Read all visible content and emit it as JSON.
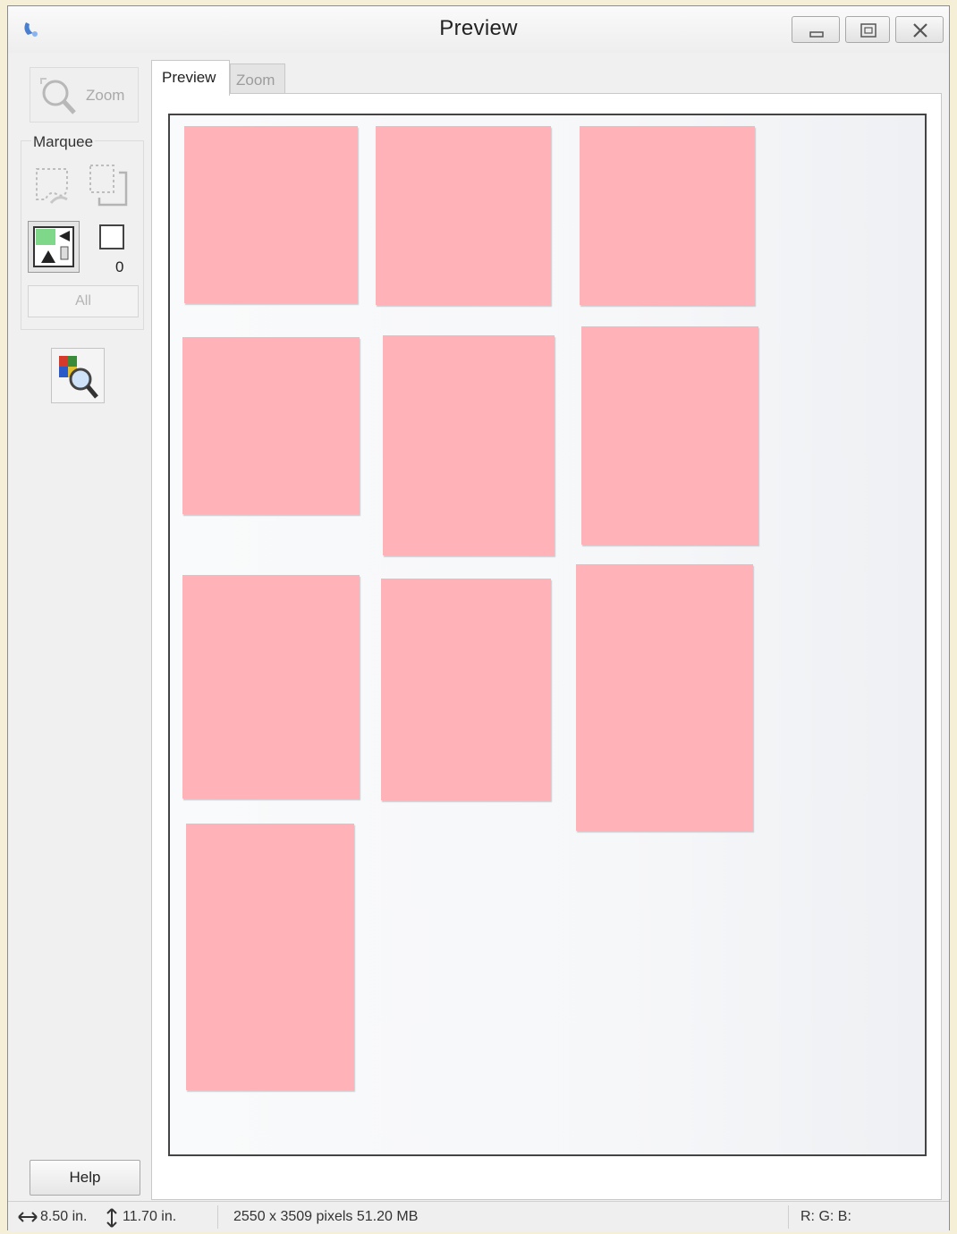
{
  "window": {
    "title": "Preview",
    "controls": {
      "minimize": "minimize",
      "maximize": "maximize",
      "close": "close"
    }
  },
  "toolbar": {
    "zoom_label": "Zoom",
    "marquee_label": "Marquee",
    "marquee_count": "0",
    "all_label": "All",
    "help_label": "Help"
  },
  "tabs": [
    {
      "label": "Preview",
      "active": true
    },
    {
      "label": "Zoom",
      "active": false
    }
  ],
  "preview": {
    "note_color": "#ffb3b9",
    "note_count": 10
  },
  "status": {
    "width": "8.50 in.",
    "height": "11.70 in.",
    "size": "2550 x 3509 pixels 51.20 MB",
    "rgb": "R: G: B:"
  },
  "icons": {
    "app": "scanner-app-icon",
    "zoom": "magnifier-icon",
    "lasso": "lasso-marquee-icon",
    "copy": "duplicate-marquee-icon",
    "auto": "auto-locate-icon",
    "frame": "marquee-frame-icon",
    "color": "color-palette-magnifier-icon",
    "width": "horizontal-arrow-icon",
    "height": "vertical-arrow-icon"
  }
}
